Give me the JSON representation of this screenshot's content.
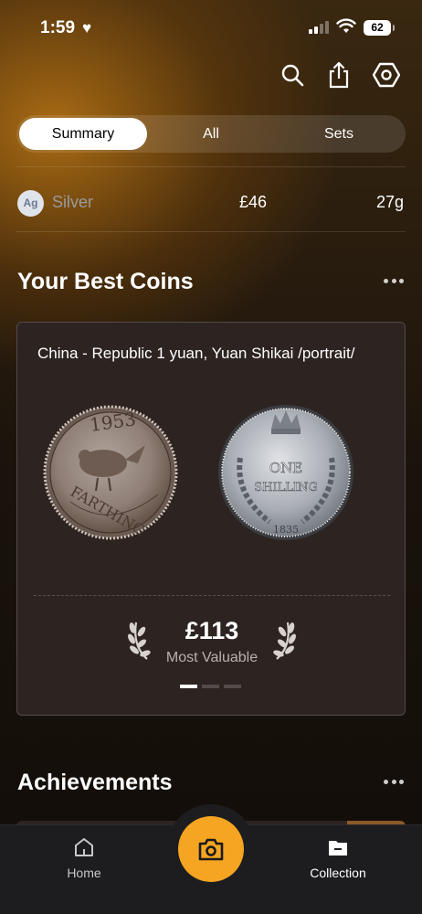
{
  "status_bar": {
    "time": "1:59",
    "heart": "♥",
    "battery": "62"
  },
  "header": {
    "icons": [
      "search-icon",
      "share-icon",
      "settings-icon"
    ]
  },
  "tabs": [
    {
      "label": "Summary",
      "active": true
    },
    {
      "label": "All",
      "active": false
    },
    {
      "label": "Sets",
      "active": false
    }
  ],
  "metal": {
    "symbol": "Ag",
    "name": "Silver",
    "value": "£46",
    "weight": "27g"
  },
  "best_coins": {
    "title": "Your Best Coins",
    "coin_title": "China - Republic 1 yuan, Yuan Shikai /portrait/",
    "value": "£113",
    "value_label": "Most Valuable",
    "page_index": 0,
    "page_count": 3
  },
  "achievements": {
    "title": "Achievements"
  },
  "nav": {
    "home_label": "Home",
    "collection_label": "Collection",
    "camera_icon": "camera-icon"
  },
  "colors": {
    "accent": "#f5a521",
    "card": "#2d2421",
    "tabbar": "#1d1d1f"
  }
}
